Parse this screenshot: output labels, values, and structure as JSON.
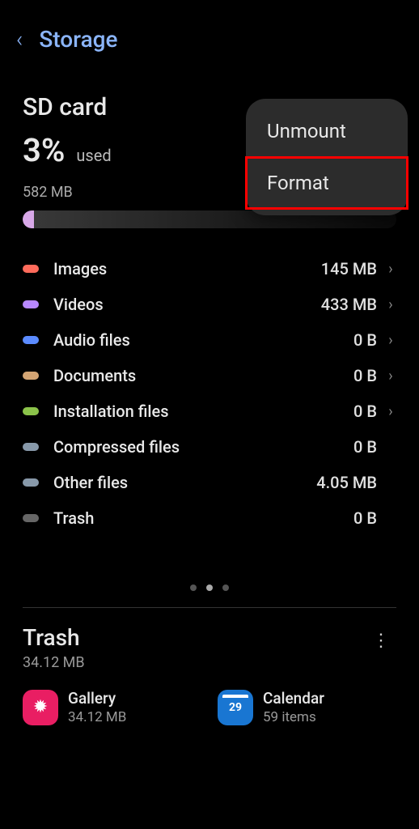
{
  "header": {
    "title": "Storage"
  },
  "sdcard": {
    "title": "SD card",
    "percent": "3%",
    "used_label": "used",
    "total_used": "582 MB"
  },
  "categories": [
    {
      "name": "Images",
      "size": "145 MB",
      "color": "#ff6b5b",
      "chevron": true
    },
    {
      "name": "Videos",
      "size": "433 MB",
      "color": "#b888ff",
      "chevron": true
    },
    {
      "name": "Audio files",
      "size": "0 B",
      "color": "#5b8bff",
      "chevron": true
    },
    {
      "name": "Documents",
      "size": "0 B",
      "color": "#d4a574",
      "chevron": true
    },
    {
      "name": "Installation files",
      "size": "0 B",
      "color": "#8bc34a",
      "chevron": true
    },
    {
      "name": "Compressed files",
      "size": "0 B",
      "color": "#8899aa",
      "chevron": false
    },
    {
      "name": "Other files",
      "size": "4.05 MB",
      "color": "#8899aa",
      "chevron": false
    },
    {
      "name": "Trash",
      "size": "0 B",
      "color": "#666",
      "chevron": false
    }
  ],
  "trash": {
    "title": "Trash",
    "size": "34.12 MB",
    "apps": [
      {
        "name": "Gallery",
        "meta": "34.12 MB",
        "icon": "gallery"
      },
      {
        "name": "Calendar",
        "meta": "59 items",
        "icon": "calendar"
      }
    ]
  },
  "popup": {
    "items": [
      {
        "label": "Unmount",
        "highlighted": false
      },
      {
        "label": "Format",
        "highlighted": true
      }
    ]
  },
  "calendar_day": "29"
}
